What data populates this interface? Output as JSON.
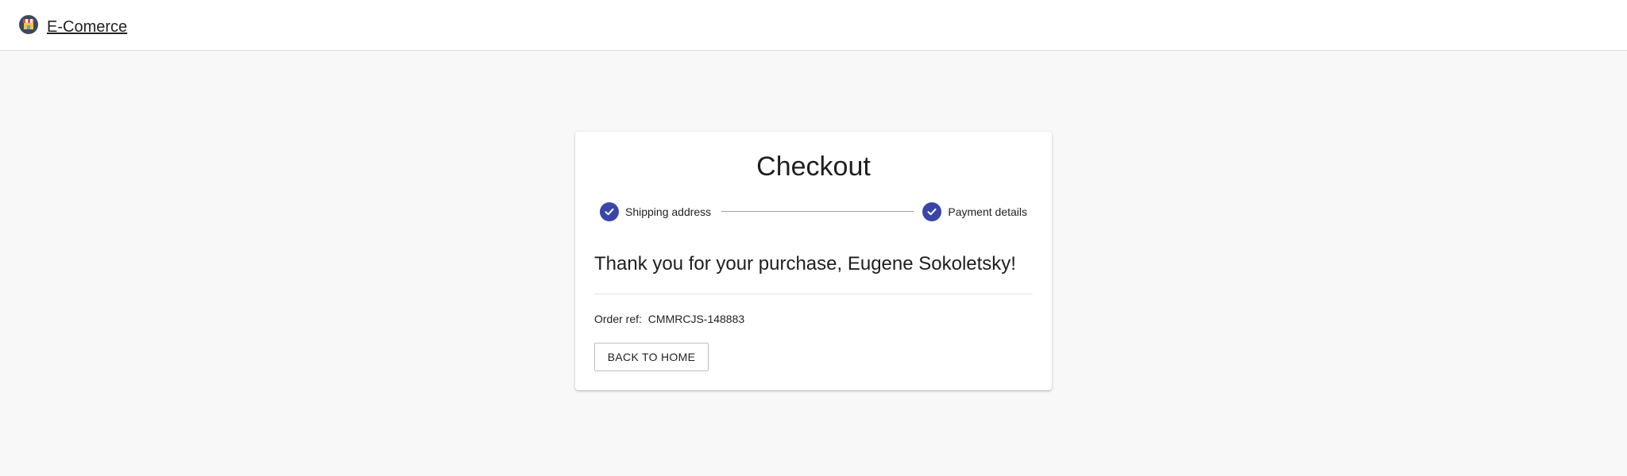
{
  "header": {
    "brand_label": "E-Comerce",
    "brand_icon": "shop-logo-icon"
  },
  "checkout": {
    "title": "Checkout",
    "steps": [
      {
        "label": "Shipping address",
        "status": "completed",
        "icon": "check-icon"
      },
      {
        "label": "Payment details",
        "status": "completed",
        "icon": "check-icon"
      }
    ],
    "thank_you_message": "Thank you for your purchase, Eugene Sokoletsky!",
    "order_ref_label": "Order ref:",
    "order_ref_value": "CMMRCJS-148883",
    "back_button_label": "BACK TO HOME"
  },
  "colors": {
    "accent": "#3a46a5",
    "background": "#f8f8f8",
    "card": "#ffffff"
  }
}
